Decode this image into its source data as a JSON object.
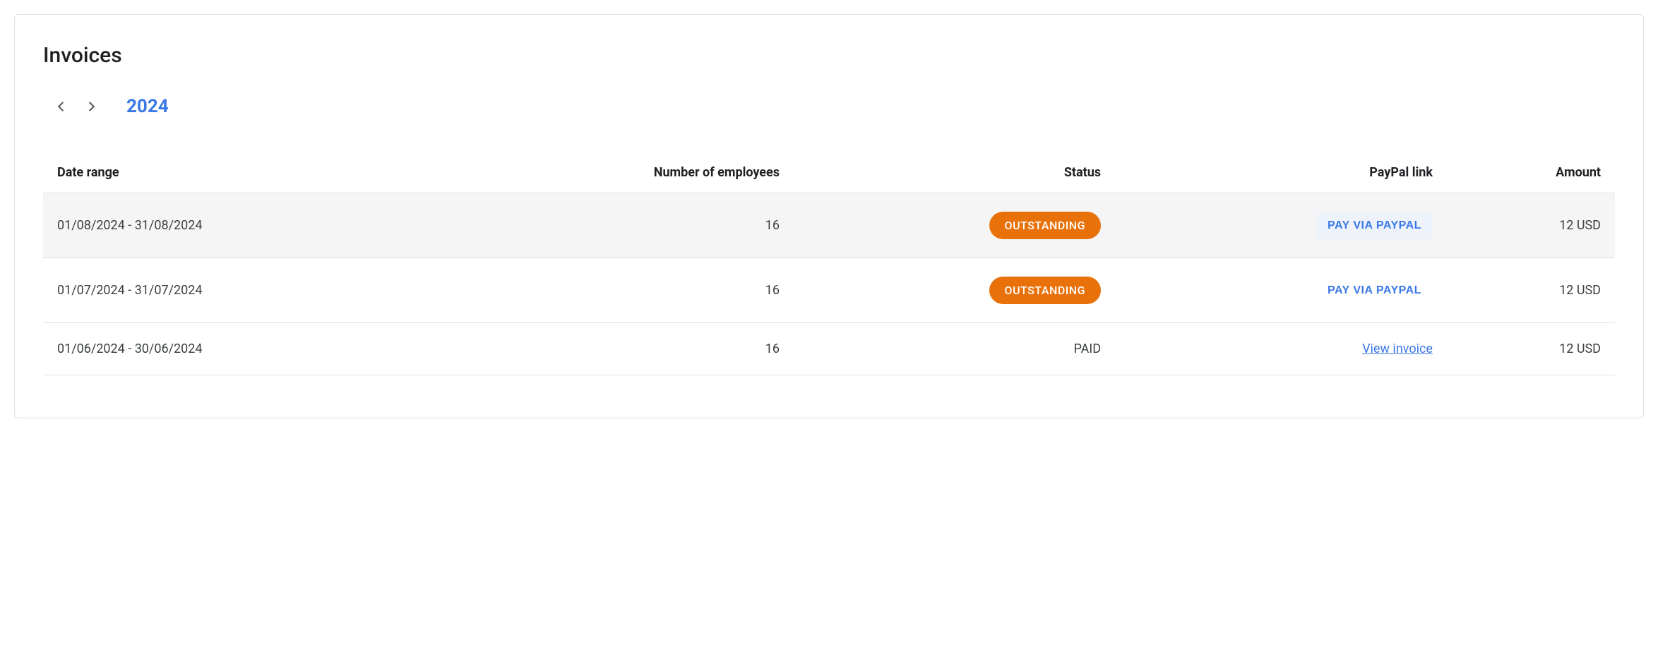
{
  "title": "Invoices",
  "year": "2024",
  "columns": {
    "date_range": "Date range",
    "employees": "Number of employees",
    "status": "Status",
    "paypal": "PayPal link",
    "amount": "Amount"
  },
  "status_labels": {
    "outstanding": "OUTSTANDING",
    "paid": "PAID"
  },
  "action_labels": {
    "pay_via_paypal": "PAY VIA PAYPAL",
    "view_invoice": "View invoice"
  },
  "rows": [
    {
      "date_range": "01/08/2024 - 31/08/2024",
      "employees": "16",
      "status": "outstanding",
      "amount": "12 USD",
      "hovered": true
    },
    {
      "date_range": "01/07/2024 - 31/07/2024",
      "employees": "16",
      "status": "outstanding",
      "amount": "12 USD",
      "hovered": false
    },
    {
      "date_range": "01/06/2024 - 30/06/2024",
      "employees": "16",
      "status": "paid",
      "amount": "12 USD",
      "hovered": false
    }
  ]
}
